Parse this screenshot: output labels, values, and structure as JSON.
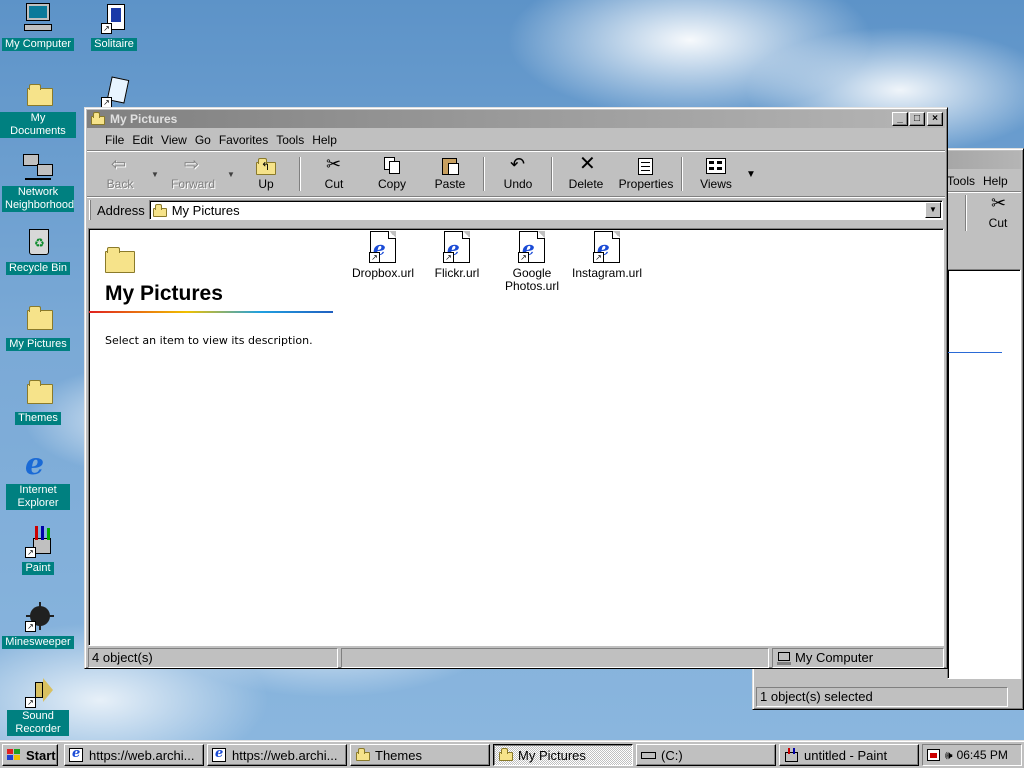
{
  "desktop": {
    "icons": [
      {
        "label": "My Computer"
      },
      {
        "label": "Solitaire"
      },
      {
        "label": "My Documents"
      },
      {
        "label": "Network Neighborhood"
      },
      {
        "label": "Recycle Bin"
      },
      {
        "label": "My Pictures"
      },
      {
        "label": "Themes"
      },
      {
        "label": "Internet Explorer"
      },
      {
        "label": "Paint"
      },
      {
        "label": "Minesweeper"
      },
      {
        "label": "Sound Recorder"
      }
    ]
  },
  "main_window": {
    "title": "My Pictures",
    "title_buttons": {
      "minimize": "_",
      "maximize": "□",
      "close": "×"
    },
    "menu": [
      "File",
      "Edit",
      "View",
      "Go",
      "Favorites",
      "Tools",
      "Help"
    ],
    "toolbar": {
      "back": "Back",
      "forward": "Forward",
      "up": "Up",
      "cut": "Cut",
      "copy": "Copy",
      "paste": "Paste",
      "undo": "Undo",
      "delete": "Delete",
      "properties": "Properties",
      "views": "Views"
    },
    "address": {
      "label": "Address",
      "value": "My Pictures"
    },
    "panel": {
      "heading": "My Pictures",
      "description": "Select an item to view its description."
    },
    "files": [
      {
        "name": "Dropbox.url"
      },
      {
        "name": "Flickr.url"
      },
      {
        "name": "Google Photos.url"
      },
      {
        "name": "Instagram.url"
      }
    ],
    "status": {
      "count": "4 object(s)",
      "zone": "My Computer"
    }
  },
  "back_window": {
    "menu": [
      "Tools",
      "Help"
    ],
    "toolbar": {
      "cut": "Cut"
    },
    "status": {
      "selection": "1 object(s) selected"
    }
  },
  "taskbar": {
    "start": "Start",
    "buttons": [
      {
        "label": "https://web.archi..."
      },
      {
        "label": "https://web.archi..."
      },
      {
        "label": "Themes"
      },
      {
        "label": "My Pictures"
      },
      {
        "label": "(C:)"
      },
      {
        "label": "untitled - Paint"
      }
    ],
    "clock": "06:45 PM"
  }
}
